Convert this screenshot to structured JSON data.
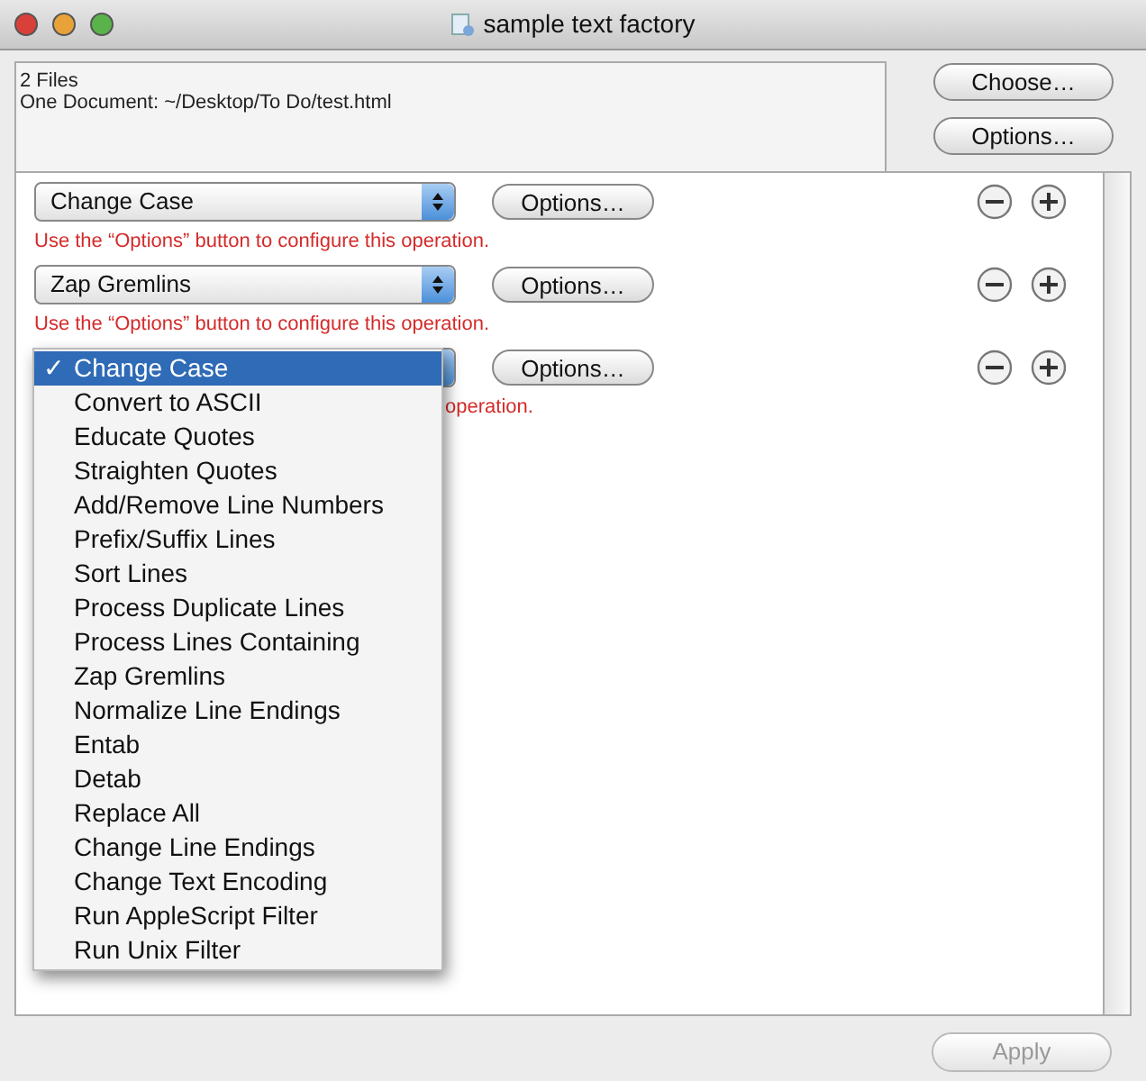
{
  "window": {
    "title": "sample text factory"
  },
  "file_info": {
    "lines": [
      "2 Files",
      "One Document: ~/Desktop/To Do/test.html"
    ]
  },
  "side_buttons": [
    {
      "label": "Choose…"
    },
    {
      "label": "Options…"
    }
  ],
  "operations": [
    {
      "popup": "Change Case",
      "options_button": "Options…",
      "hint": "Use the “Options” button to configure this operation."
    },
    {
      "popup": "Zap Gremlins",
      "options_button": "Options…",
      "hint": "Use the “Options” button to configure this operation."
    },
    {
      "options_button": "Options…",
      "hint": "operation."
    }
  ],
  "menu": {
    "check_mark": "✓",
    "items": [
      {
        "label": "Change Case",
        "selected": true
      },
      {
        "label": "Convert to ASCII",
        "selected": false
      },
      {
        "label": "Educate Quotes",
        "selected": false
      },
      {
        "label": "Straighten Quotes",
        "selected": false
      },
      {
        "label": "Add/Remove Line Numbers",
        "selected": false
      },
      {
        "label": "Prefix/Suffix Lines",
        "selected": false
      },
      {
        "label": "Sort Lines",
        "selected": false
      },
      {
        "label": "Process Duplicate Lines",
        "selected": false
      },
      {
        "label": "Process Lines Containing",
        "selected": false
      },
      {
        "label": "Zap Gremlins",
        "selected": false
      },
      {
        "label": "Normalize Line Endings",
        "selected": false
      },
      {
        "label": "Entab",
        "selected": false
      },
      {
        "label": "Detab",
        "selected": false
      },
      {
        "label": "Replace All",
        "selected": false
      },
      {
        "label": "Change Line Endings",
        "selected": false
      },
      {
        "label": "Change Text Encoding",
        "selected": false
      },
      {
        "label": "Run AppleScript Filter",
        "selected": false
      },
      {
        "label": "Run Unix Filter",
        "selected": false
      }
    ]
  },
  "apply_button": {
    "label": "Apply",
    "disabled": true
  }
}
